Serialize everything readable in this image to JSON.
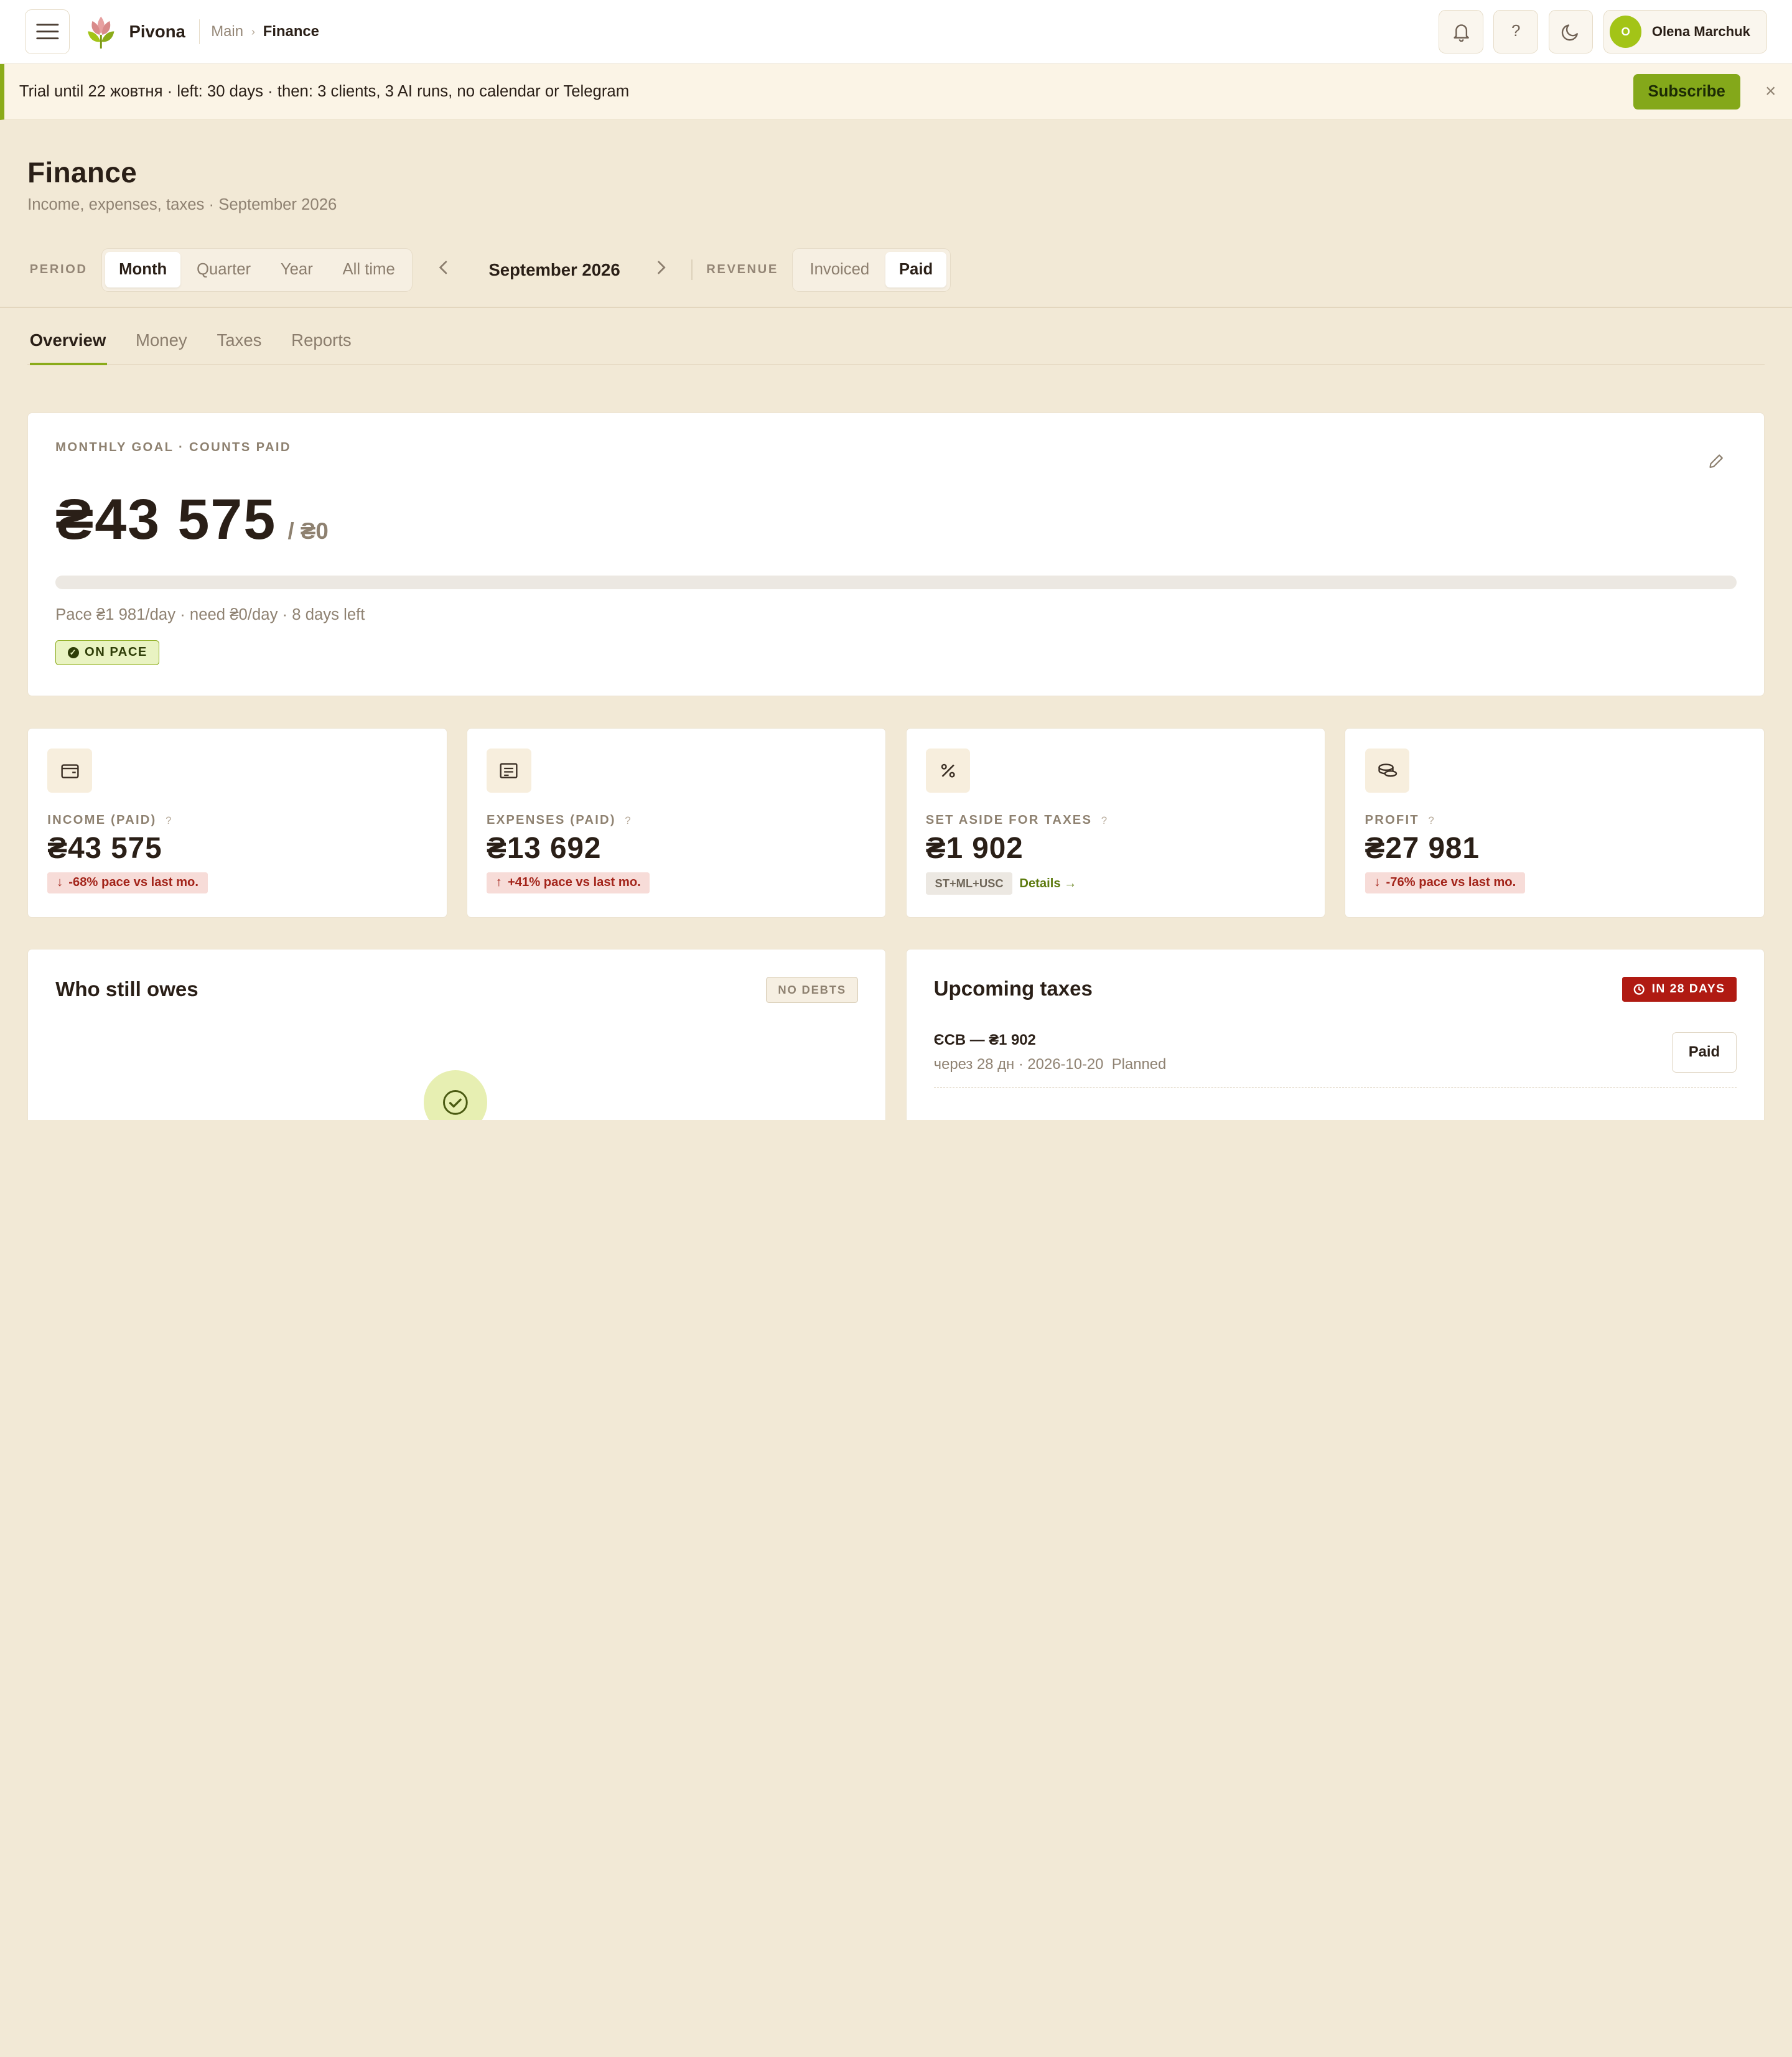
{
  "brand": {
    "name": "Pivona"
  },
  "breadcrumb": {
    "main": "Main",
    "current": "Finance"
  },
  "topbar": {
    "help_label": "?",
    "user_initial": "O",
    "user_name": "Olena Marchuk"
  },
  "trial": {
    "text": "Trial until 22 жовтня · left: 30 days · then: 3 clients, 3 AI runs, no calendar or Telegram",
    "subscribe_label": "Subscribe",
    "close_label": "×"
  },
  "page": {
    "title": "Finance",
    "subtitle": "Income, expenses, taxes · September 2026"
  },
  "controls": {
    "period_label": "PERIOD",
    "periods": [
      "Month",
      "Quarter",
      "Year",
      "All time"
    ],
    "active_period": "Month",
    "month_label": "September 2026",
    "revenue_label": "REVENUE",
    "revenue_modes": [
      "Invoiced",
      "Paid"
    ],
    "active_revenue": "Paid"
  },
  "tabs": [
    "Overview",
    "Money",
    "Taxes",
    "Reports"
  ],
  "goal": {
    "label": "MONTHLY GOAL · COUNTS PAID",
    "amount": "₴43 575",
    "target": "/ ₴0",
    "progress_fraction": 0,
    "pace_text": "Pace ₴1 981/day · need ₴0/day · 8 days left",
    "status": "ON PACE"
  },
  "kpis": [
    {
      "label": "INCOME (PAID)",
      "value": "₴43 575",
      "delta": "-68% pace vs last mo.",
      "direction": "down",
      "icon": "wallet-icon"
    },
    {
      "label": "EXPENSES (PAID)",
      "value": "₴13 692",
      "delta": "+41% pace vs last mo.",
      "direction": "up",
      "icon": "receipt-icon"
    },
    {
      "label": "SET ASIDE FOR TAXES",
      "value": "₴1 902",
      "chip": "ST+ML+USC",
      "link": "Details →",
      "icon": "percent-icon"
    },
    {
      "label": "PROFIT",
      "value": "₴27 981",
      "delta": "-76% pace vs last mo.",
      "direction": "down",
      "icon": "coins-icon"
    }
  ],
  "owes": {
    "title": "Who still owes",
    "badge": "NO DEBTS"
  },
  "taxes": {
    "title": "Upcoming taxes",
    "badge": "IN 28 DAYS",
    "items": [
      {
        "name": "ЄСВ — ₴1 902",
        "sub": "через 28 дн · 2026-10-20  Planned",
        "action": "Paid"
      }
    ]
  },
  "colors": {
    "accent": "#8bab1a",
    "danger": "#b01a12",
    "background": "#f2e9d6"
  }
}
